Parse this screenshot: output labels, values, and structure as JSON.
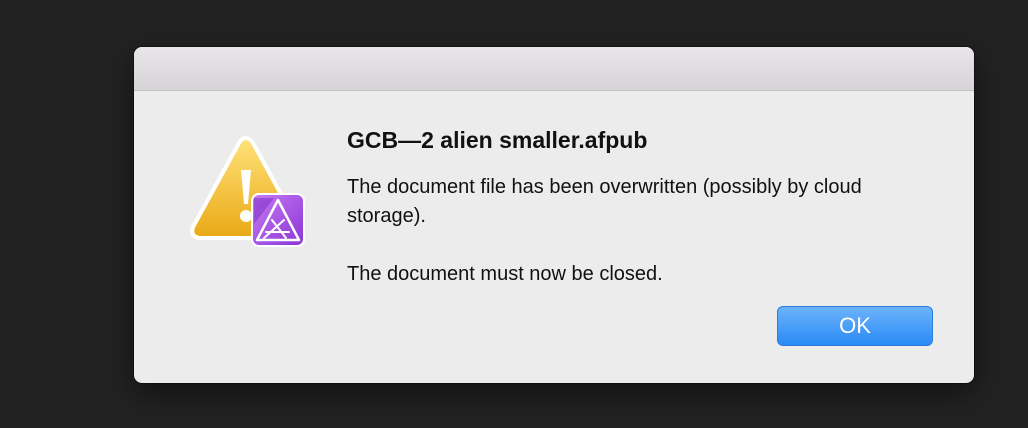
{
  "dialog": {
    "title": "GCB—2 alien smaller.afpub",
    "message_line1": "The document file has been overwritten (possibly by cloud storage).",
    "message_line2": "The document must now be closed.",
    "ok_label": "OK",
    "icons": {
      "warning": "warning-triangle-icon",
      "app_badge": "affinity-publisher-app-icon"
    }
  },
  "colors": {
    "desktop_background": "#222223",
    "dialog_background": "#ececec",
    "button_accent": "#2a8af6",
    "warning_yellow": "#f2c12e",
    "app_badge_purple": "#a64de0"
  }
}
